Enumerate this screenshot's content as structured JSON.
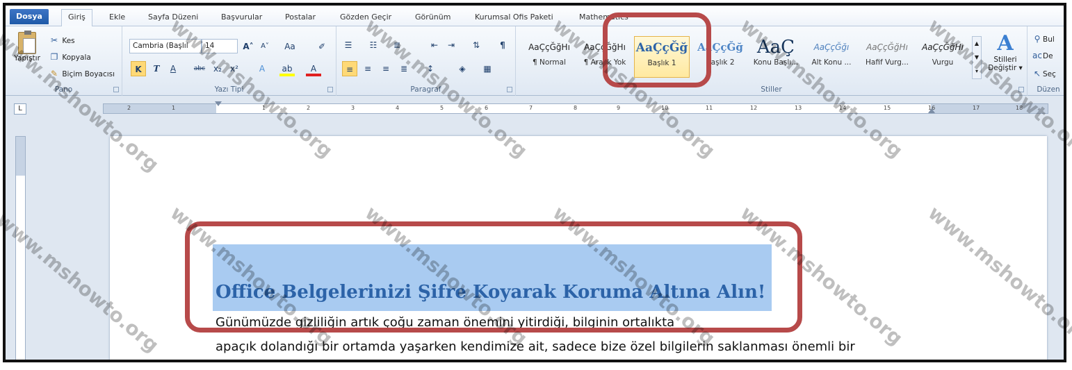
{
  "tabs": [
    "Dosya",
    "Giriş",
    "Ekle",
    "Sayfa Düzeni",
    "Başvurular",
    "Postalar",
    "Gözden Geçir",
    "Görünüm",
    "Kurumsal Ofis Paketi",
    "Mathematics"
  ],
  "clipboard": {
    "paste": "Yapıştır",
    "cut": "Kes",
    "copy": "Kopyala",
    "format_painter": "Biçim Boyacısı",
    "label": "Pano"
  },
  "font": {
    "name": "Cambria (Başlıl",
    "size": "14",
    "label": "Yazı Tipi",
    "bold": "K",
    "italic": "T",
    "underline": "A",
    "strike": "abc",
    "sub": "x₂",
    "sup": "x²",
    "grow": "A˄",
    "shrink": "A˅",
    "case": "Aa"
  },
  "paragraph": {
    "label": "Paragraf"
  },
  "styles": {
    "label": "Stiller",
    "items": [
      {
        "preview": "AaÇçĞğHı",
        "name": "¶ Normal"
      },
      {
        "preview": "AaÇçĞğHı",
        "name": "¶ Aralık Yok"
      },
      {
        "preview": "AaÇçĞğ",
        "name": "Başlık 1"
      },
      {
        "preview": "AaÇçĞğ",
        "name": "Başlık 2"
      },
      {
        "preview": "AaÇ",
        "name": "Konu Başlı..."
      },
      {
        "preview": "AaÇçĞğı",
        "name": "Alt Konu ..."
      },
      {
        "preview": "AaÇçĞğHı",
        "name": "Hafif Vurg..."
      },
      {
        "preview": "AaÇçĞğHı",
        "name": "Vurgu"
      }
    ],
    "change_line1": "Stilleri",
    "change_line2": "Değiştir ▾"
  },
  "editing": {
    "find": "Bul",
    "replace": "De",
    "select": "Seç",
    "label": "Düzen"
  },
  "ruler_numbers": [
    "2",
    "1",
    "1",
    "2",
    "3",
    "4",
    "5",
    "6",
    "7",
    "8",
    "9",
    "10",
    "11",
    "12",
    "13",
    "14",
    "15",
    "16",
    "17",
    "18"
  ],
  "tab_selector": "L",
  "document": {
    "heading": "Office Belgelerinizi Şifre Koyarak Koruma Altına Alın!",
    "line1": "Günümüzde gizliliğin artık çoğu zaman önemini yitirdiği, bilginin ortalıkta",
    "line2": "apaçık dolandığı bir ortamda yaşarken kendimize ait, sadece bize özel bilgilerin saklanması önemli bir"
  },
  "watermark": "www.mshowto.org",
  "colors": {
    "highlight_border": "#b74a4a",
    "selection": "#a9cbf1",
    "heading": "#2c63a8",
    "file_tab": "#2a64b4"
  }
}
